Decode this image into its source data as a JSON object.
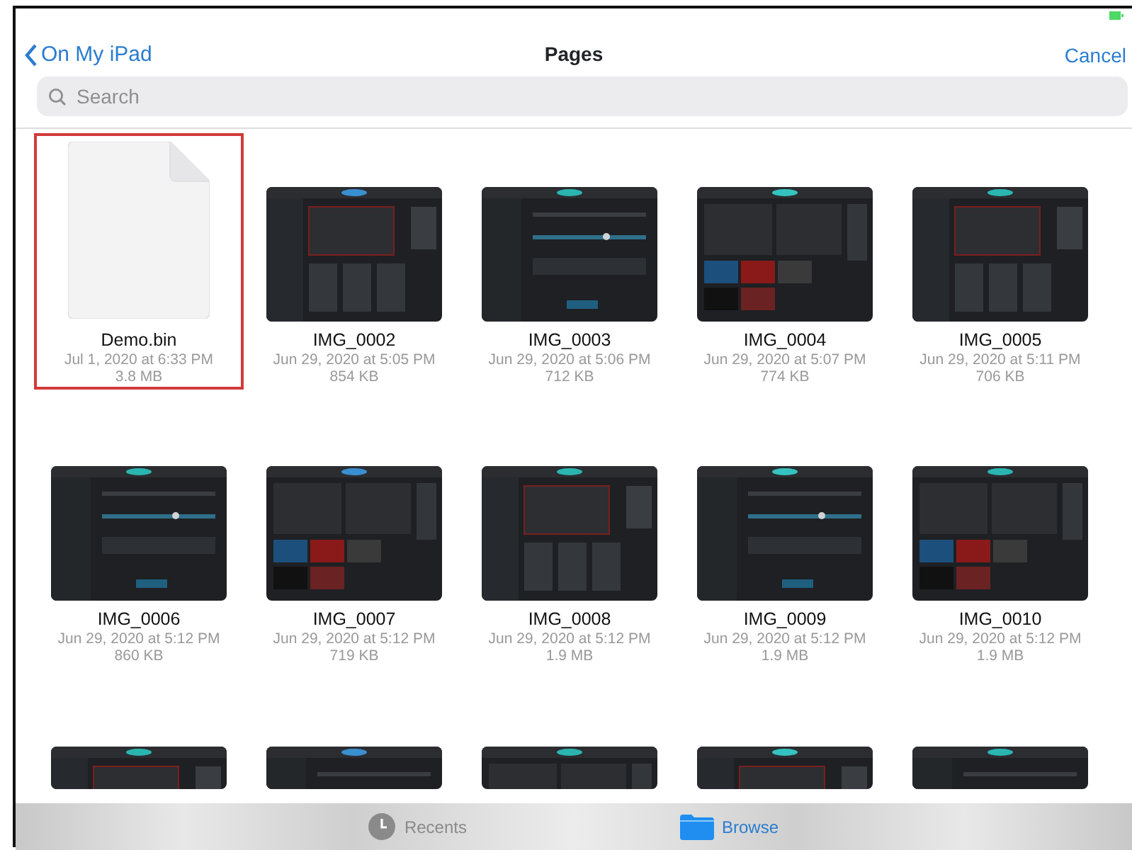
{
  "nav": {
    "back": "On My iPad",
    "title": "Pages",
    "cancel": "Cancel"
  },
  "search": {
    "placeholder": "Search"
  },
  "files": [
    {
      "kind": "document",
      "name": "Demo.bin",
      "date": "Jul 1, 2020 at 6:33 PM",
      "size": "3.8 MB",
      "selected": true
    },
    {
      "kind": "picture",
      "name": "IMG_0002",
      "date": "Jun 29, 2020 at 5:05 PM",
      "size": "854 KB",
      "selected": false
    },
    {
      "kind": "picture",
      "name": "IMG_0003",
      "date": "Jun 29, 2020 at 5:06 PM",
      "size": "712 KB",
      "selected": false
    },
    {
      "kind": "picture",
      "name": "IMG_0004",
      "date": "Jun 29, 2020 at 5:07 PM",
      "size": "774 KB",
      "selected": false
    },
    {
      "kind": "picture",
      "name": "IMG_0005",
      "date": "Jun 29, 2020 at 5:11 PM",
      "size": "706 KB",
      "selected": false
    },
    {
      "kind": "picture",
      "name": "IMG_0006",
      "date": "Jun 29, 2020 at 5:12 PM",
      "size": "860 KB",
      "selected": false
    },
    {
      "kind": "picture",
      "name": "IMG_0007",
      "date": "Jun 29, 2020 at 5:12 PM",
      "size": "719 KB",
      "selected": false
    },
    {
      "kind": "picture",
      "name": "IMG_0008",
      "date": "Jun 29, 2020 at 5:12 PM",
      "size": "1.9 MB",
      "selected": false
    },
    {
      "kind": "picture",
      "name": "IMG_0009",
      "date": "Jun 29, 2020 at 5:12 PM",
      "size": "1.9 MB",
      "selected": false
    },
    {
      "kind": "picture",
      "name": "IMG_0010",
      "date": "Jun 29, 2020 at 5:12 PM",
      "size": "1.9 MB",
      "selected": false
    },
    {
      "kind": "picture"
    },
    {
      "kind": "picture"
    },
    {
      "kind": "picture"
    },
    {
      "kind": "picture"
    },
    {
      "kind": "picture"
    }
  ],
  "tab_bar": [
    {
      "label": "Recents",
      "selected": false
    },
    {
      "label": "Browse",
      "selected": true
    }
  ]
}
